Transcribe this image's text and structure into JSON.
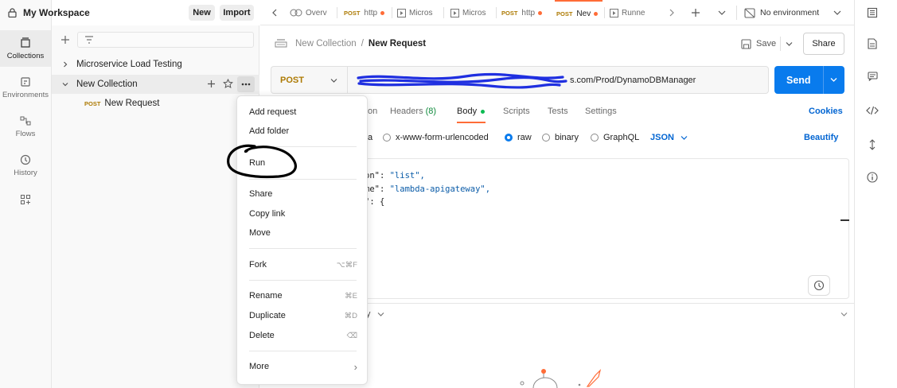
{
  "workspace": {
    "title": "My Workspace",
    "new_label": "New",
    "import_label": "Import"
  },
  "rail": {
    "items": [
      {
        "label": "Collections",
        "icon": "collections-icon"
      },
      {
        "label": "Environments",
        "icon": "environments-icon"
      },
      {
        "label": "Flows",
        "icon": "flows-icon"
      },
      {
        "label": "History",
        "icon": "history-icon"
      },
      {
        "label": "",
        "icon": "add-apps-icon"
      }
    ]
  },
  "sidebar": {
    "tree": [
      {
        "label": "Microservice Load Testing",
        "expanded": false
      },
      {
        "label": "New Collection",
        "expanded": true
      },
      {
        "method": "POST",
        "label": "New Request"
      }
    ]
  },
  "tabs": [
    {
      "label": "Overv",
      "icon": "overview-icon"
    },
    {
      "method": "POST",
      "label": "http",
      "dirty": true
    },
    {
      "label": "Micros",
      "icon": "runner-icon"
    },
    {
      "label": "Micros",
      "icon": "runner-icon"
    },
    {
      "method": "POST",
      "label": "http",
      "dirty": true
    },
    {
      "method": "POST",
      "label": "Nev",
      "dirty": true,
      "active": true
    },
    {
      "label": "Runne",
      "icon": "runner-icon"
    }
  ],
  "environment": {
    "selected": "No environment"
  },
  "request": {
    "breadcrumb_collection": "New Collection",
    "breadcrumb_separator": "/",
    "name": "New Request",
    "save_label": "Save",
    "share_label": "Share",
    "method": "POST",
    "url_visible_tail": "s.com/Prod/DynamoDBManager",
    "send_label": "Send",
    "tabs": [
      {
        "label": "on"
      },
      {
        "label": "Headers",
        "count": "(8)"
      },
      {
        "label": "Body",
        "active": true
      },
      {
        "label": "Scripts"
      },
      {
        "label": "Tests"
      },
      {
        "label": "Settings"
      }
    ],
    "cookies_label": "Cookies",
    "body_types": [
      {
        "label": "a",
        "selected": false
      },
      {
        "label": "x-www-form-urlencoded",
        "selected": false
      },
      {
        "label": "raw",
        "selected": true
      },
      {
        "label": "binary",
        "selected": false
      },
      {
        "label": "GraphQL",
        "selected": false
      }
    ],
    "format": "JSON",
    "beautify_label": "Beautify",
    "code_lines": [
      {
        "key": "on\": ",
        "value": "\"list\","
      },
      {
        "key": "me\": ",
        "value": "\"lambda-apigateway\","
      },
      {
        "key": "\": {",
        "value": ""
      }
    ],
    "response_label": "y"
  },
  "context_menu": {
    "groups": [
      [
        {
          "label": "Add request"
        },
        {
          "label": "Add folder"
        }
      ],
      [
        {
          "label": "Run"
        }
      ],
      [
        {
          "label": "Share"
        },
        {
          "label": "Copy link"
        },
        {
          "label": "Move"
        }
      ],
      [
        {
          "label": "Fork",
          "shortcut": "⌥⌘F"
        }
      ],
      [
        {
          "label": "Rename",
          "shortcut": "⌘E"
        },
        {
          "label": "Duplicate",
          "shortcut": "⌘D"
        },
        {
          "label": "Delete",
          "shortcut": "⌫"
        }
      ],
      [
        {
          "label": "More",
          "shortcut": "›"
        }
      ]
    ]
  },
  "colors": {
    "accent": "#ff6c37",
    "send": "#097bed",
    "post_method": "#ad7a03",
    "link_blue": "#0265d2",
    "annotation_ink": "#000000",
    "redaction_ink": "#1f2fe0"
  }
}
